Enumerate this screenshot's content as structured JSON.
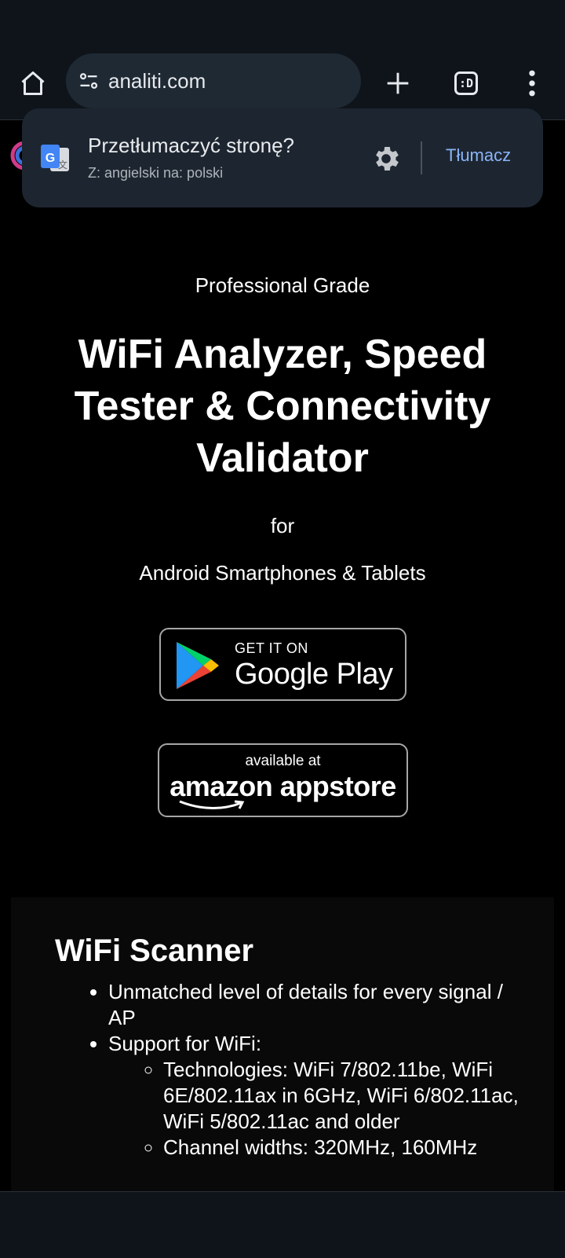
{
  "browser": {
    "url": "analiti.com",
    "tab_count": ":D"
  },
  "translate_popup": {
    "title": "Przetłumaczyć stronę?",
    "subtitle": "Z: angielski na: polski",
    "action": "Tłumacz"
  },
  "hero": {
    "subtitle": "Professional Grade",
    "title": "WiFi Analyzer, Speed Tester & Connectivity Validator",
    "for": "for",
    "platform": "Android Smartphones & Tablets"
  },
  "badges": {
    "google_play": {
      "small": "GET IT ON",
      "big": "Google Play"
    },
    "amazon": {
      "small": "available at",
      "big": "amazon appstore"
    }
  },
  "features": {
    "title": "WiFi Scanner",
    "items": [
      "Unmatched level of details for every signal / AP",
      "Support for WiFi:"
    ],
    "subitems": [
      "Technologies: WiFi 7/802.11be, WiFi 6E/802.11ax in 6GHz, WiFi 6/802.11ac, WiFi 5/802.11ac and older",
      "Channel widths: 320MHz, 160MHz"
    ]
  },
  "icons": {
    "home": "home-icon",
    "tune": "tune-icon",
    "new_tab": "plus-icon",
    "menu": "more-vert-icon",
    "translate": "google-translate-icon",
    "settings": "gear-icon"
  },
  "colors": {
    "accent": "#8ab4f8",
    "toolbar_bg": "#0f141b",
    "popup_bg": "#1d2630"
  }
}
